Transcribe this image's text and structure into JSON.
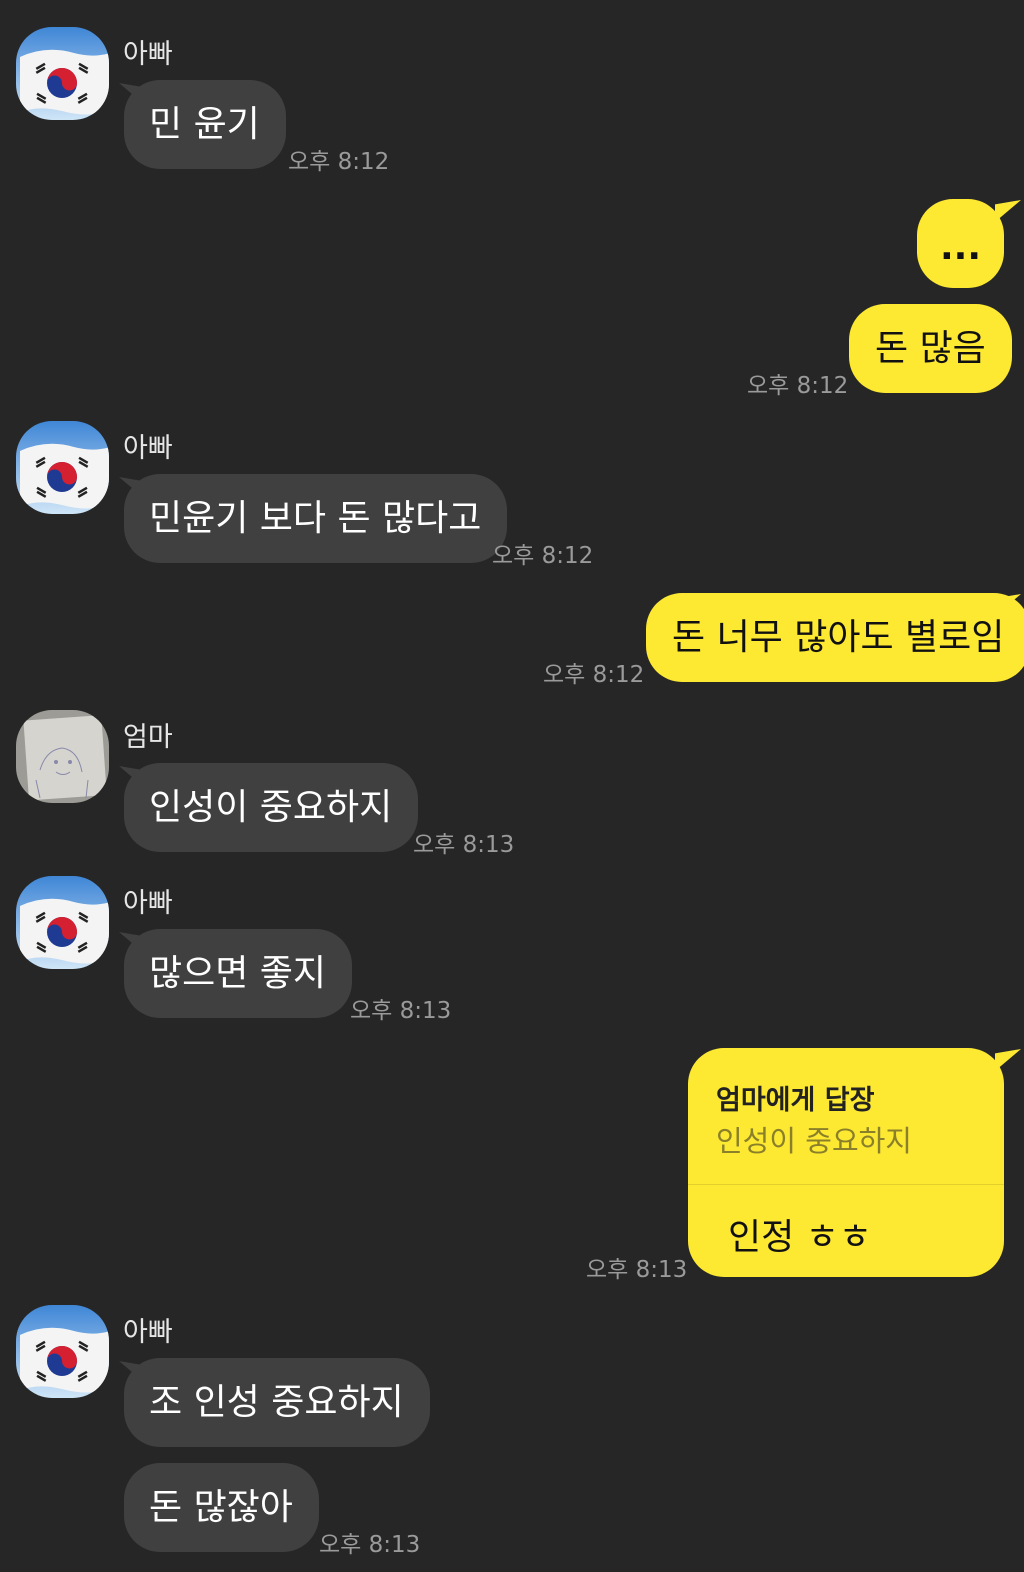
{
  "theme": {
    "background": "#262626",
    "incoming_bubble": "#404040",
    "outgoing_bubble": "#fde832",
    "time_color": "#9a9a9a"
  },
  "messages": [
    {
      "sender": "아빠",
      "text": "민 윤기",
      "time": "오후 8:12"
    },
    {
      "mine_1": "...",
      "mine_2": "돈 많음",
      "time": "오후 8:12"
    },
    {
      "sender": "아빠",
      "text": "민윤기 보다 돈 많다고",
      "time": "오후 8:12"
    },
    {
      "mine": "돈 너무 많아도 별로임",
      "time": "오후 8:12"
    },
    {
      "sender": "엄마",
      "text": "인성이 중요하지",
      "time": "오후 8:13"
    },
    {
      "sender": "아빠",
      "text": "많으면 좋지",
      "time": "오후 8:13"
    },
    {
      "reply_label": "엄마에게 답장",
      "reply_quote": "인성이 중요하지",
      "reply_text": "인정 ㅎㅎ",
      "time": "오후 8:13"
    },
    {
      "sender": "아빠",
      "text_1": "조 인성 중요하지",
      "text_2": "돈 많잖아",
      "time": "오후 8:13"
    }
  ]
}
